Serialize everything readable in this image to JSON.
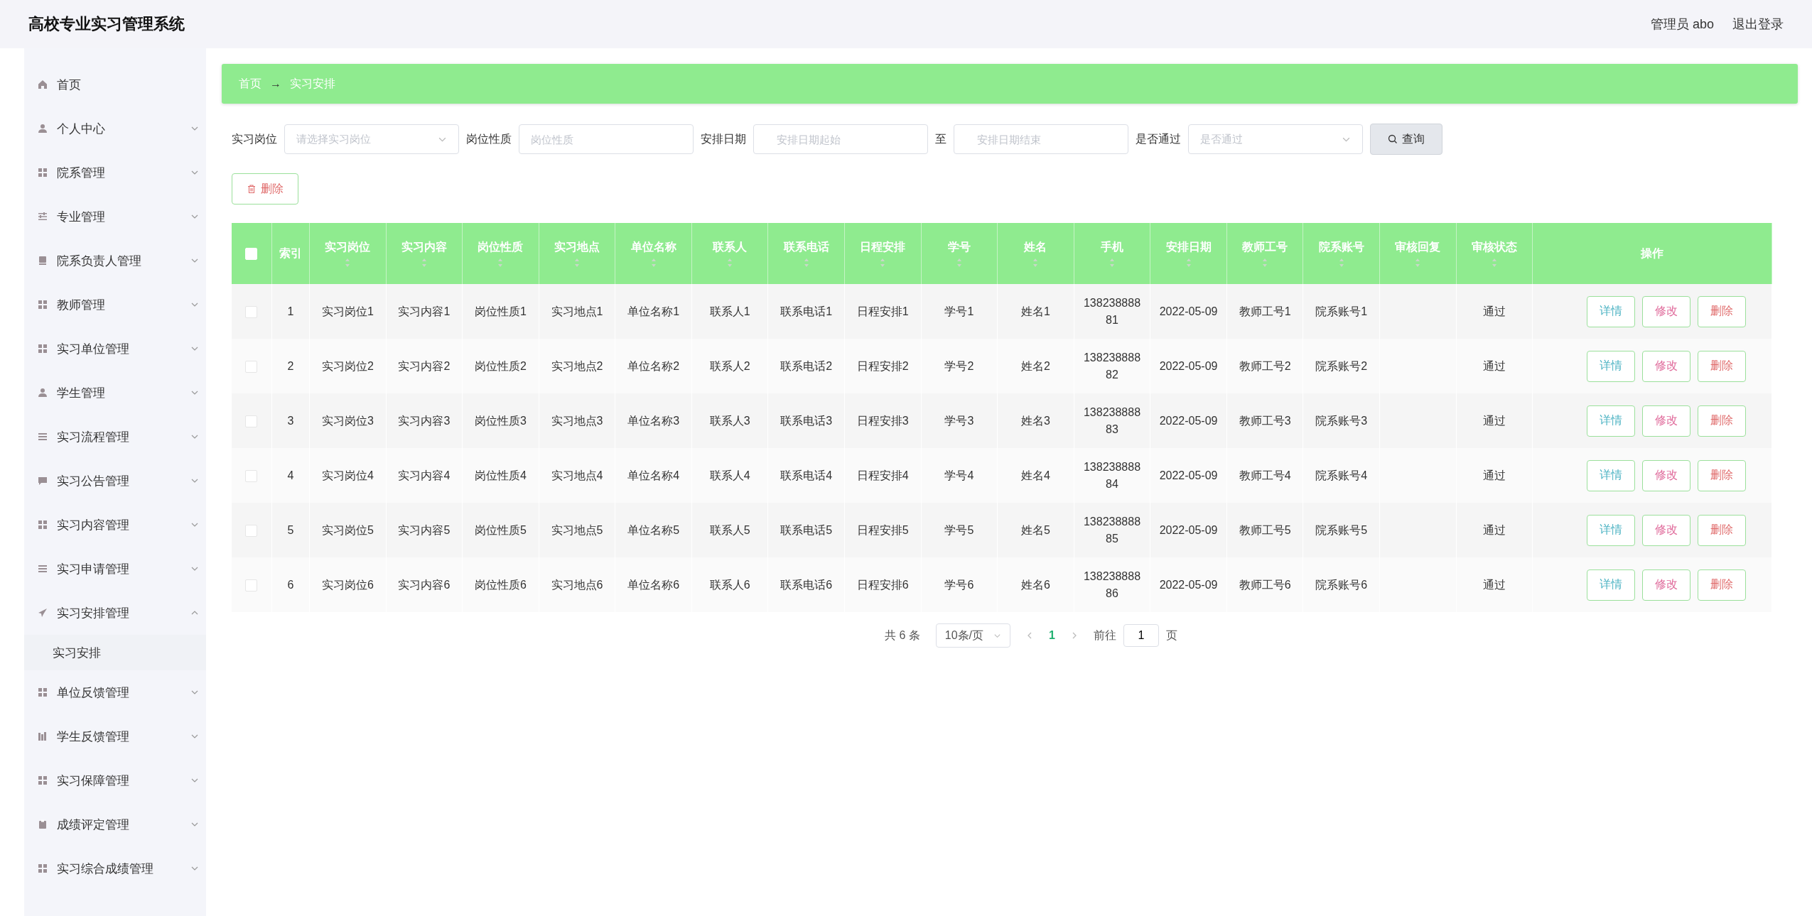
{
  "header": {
    "title": "高校专业实习管理系统",
    "user": "管理员 abo",
    "logout": "退出登录"
  },
  "sidebar": {
    "items": [
      {
        "label": "首页",
        "kind": "link"
      },
      {
        "label": "个人中心",
        "kind": "submenu",
        "expanded": false
      },
      {
        "label": "院系管理",
        "kind": "submenu",
        "expanded": false
      },
      {
        "label": "专业管理",
        "kind": "submenu",
        "expanded": false
      },
      {
        "label": "院系负责人管理",
        "kind": "submenu",
        "expanded": false
      },
      {
        "label": "教师管理",
        "kind": "submenu",
        "expanded": false
      },
      {
        "label": "实习单位管理",
        "kind": "submenu",
        "expanded": false
      },
      {
        "label": "学生管理",
        "kind": "submenu",
        "expanded": false
      },
      {
        "label": "实习流程管理",
        "kind": "submenu",
        "expanded": false
      },
      {
        "label": "实习公告管理",
        "kind": "submenu",
        "expanded": false
      },
      {
        "label": "实习内容管理",
        "kind": "submenu",
        "expanded": false
      },
      {
        "label": "实习申请管理",
        "kind": "submenu",
        "expanded": false
      },
      {
        "label": "实习安排管理",
        "kind": "submenu",
        "expanded": true,
        "children": [
          {
            "label": "实习安排",
            "selected": true
          }
        ]
      },
      {
        "label": "单位反馈管理",
        "kind": "submenu",
        "expanded": false
      },
      {
        "label": "学生反馈管理",
        "kind": "submenu",
        "expanded": false
      },
      {
        "label": "实习保障管理",
        "kind": "submenu",
        "expanded": false
      },
      {
        "label": "成绩评定管理",
        "kind": "submenu",
        "expanded": false
      },
      {
        "label": "实习综合成绩管理",
        "kind": "submenu",
        "expanded": false
      }
    ]
  },
  "breadcrumb": {
    "items": [
      "首页",
      "实习安排"
    ],
    "separator": "→"
  },
  "filters": [
    {
      "kind": "select",
      "label": "实习岗位",
      "placeholder": "请选择实习岗位"
    },
    {
      "kind": "input",
      "label": "岗位性质",
      "placeholder": "岗位性质"
    },
    {
      "kind": "range",
      "label": "安排日期",
      "placeholder": "安排日期起始",
      "joiner": "至",
      "placeholder_end": "安排日期结束"
    },
    {
      "kind": "select",
      "label": "是否通过",
      "placeholder": "是否通过"
    }
  ],
  "search_button": "查询",
  "delete_button": "删除",
  "table": {
    "select_all": {
      "checked": false
    },
    "columns": [
      {
        "label": "索引",
        "sortable": false
      },
      {
        "label": "实习岗位",
        "sortable": true
      },
      {
        "label": "实习内容",
        "sortable": true
      },
      {
        "label": "岗位性质",
        "sortable": true
      },
      {
        "label": "实习地点",
        "sortable": true
      },
      {
        "label": "单位名称",
        "sortable": true
      },
      {
        "label": "联系人",
        "sortable": true
      },
      {
        "label": "联系电话",
        "sortable": true
      },
      {
        "label": "日程安排",
        "sortable": true
      },
      {
        "label": "学号",
        "sortable": true
      },
      {
        "label": "姓名",
        "sortable": true
      },
      {
        "label": "手机",
        "sortable": true
      },
      {
        "label": "安排日期",
        "sortable": true
      },
      {
        "label": "教师工号",
        "sortable": true
      },
      {
        "label": "院系账号",
        "sortable": true
      },
      {
        "label": "审核回复",
        "sortable": true
      },
      {
        "label": "审核状态",
        "sortable": true
      },
      {
        "label": "操作",
        "sortable": false
      }
    ],
    "rows": [
      {
        "checked": false,
        "cells": [
          "1",
          "实习岗位1",
          "实习内容1",
          "岗位性质1",
          "实习地点1",
          "单位名称1",
          "联系人1",
          "联系电话1",
          "日程安排1",
          "学号1",
          "姓名1",
          "13823888881",
          "2022-05-09",
          "教师工号1",
          "院系账号1",
          "",
          "通过"
        ],
        "actions": [
          "详情",
          "修改",
          "删除"
        ]
      },
      {
        "checked": false,
        "cells": [
          "2",
          "实习岗位2",
          "实习内容2",
          "岗位性质2",
          "实习地点2",
          "单位名称2",
          "联系人2",
          "联系电话2",
          "日程安排2",
          "学号2",
          "姓名2",
          "13823888882",
          "2022-05-09",
          "教师工号2",
          "院系账号2",
          "",
          "通过"
        ],
        "actions": [
          "详情",
          "修改",
          "删除"
        ]
      },
      {
        "checked": false,
        "cells": [
          "3",
          "实习岗位3",
          "实习内容3",
          "岗位性质3",
          "实习地点3",
          "单位名称3",
          "联系人3",
          "联系电话3",
          "日程安排3",
          "学号3",
          "姓名3",
          "13823888883",
          "2022-05-09",
          "教师工号3",
          "院系账号3",
          "",
          "通过"
        ],
        "actions": [
          "详情",
          "修改",
          "删除"
        ]
      },
      {
        "checked": false,
        "cells": [
          "4",
          "实习岗位4",
          "实习内容4",
          "岗位性质4",
          "实习地点4",
          "单位名称4",
          "联系人4",
          "联系电话4",
          "日程安排4",
          "学号4",
          "姓名4",
          "13823888884",
          "2022-05-09",
          "教师工号4",
          "院系账号4",
          "",
          "通过"
        ],
        "actions": [
          "详情",
          "修改",
          "删除"
        ]
      },
      {
        "checked": false,
        "cells": [
          "5",
          "实习岗位5",
          "实习内容5",
          "岗位性质5",
          "实习地点5",
          "单位名称5",
          "联系人5",
          "联系电话5",
          "日程安排5",
          "学号5",
          "姓名5",
          "13823888885",
          "2022-05-09",
          "教师工号5",
          "院系账号5",
          "",
          "通过"
        ],
        "actions": [
          "详情",
          "修改",
          "删除"
        ]
      },
      {
        "checked": false,
        "cells": [
          "6",
          "实习岗位6",
          "实习内容6",
          "岗位性质6",
          "实习地点6",
          "单位名称6",
          "联系人6",
          "联系电话6",
          "日程安排6",
          "学号6",
          "姓名6",
          "13823888886",
          "2022-05-09",
          "教师工号6",
          "院系账号6",
          "",
          "通过"
        ],
        "actions": [
          "详情",
          "修改",
          "删除"
        ]
      }
    ]
  },
  "pagination": {
    "total": "共 6 条",
    "page_size": "10条/页",
    "pages": [
      {
        "label": "1",
        "selected": true
      }
    ],
    "goto_label": "前往",
    "goto_value": "1",
    "goto_suffix": "页"
  }
}
